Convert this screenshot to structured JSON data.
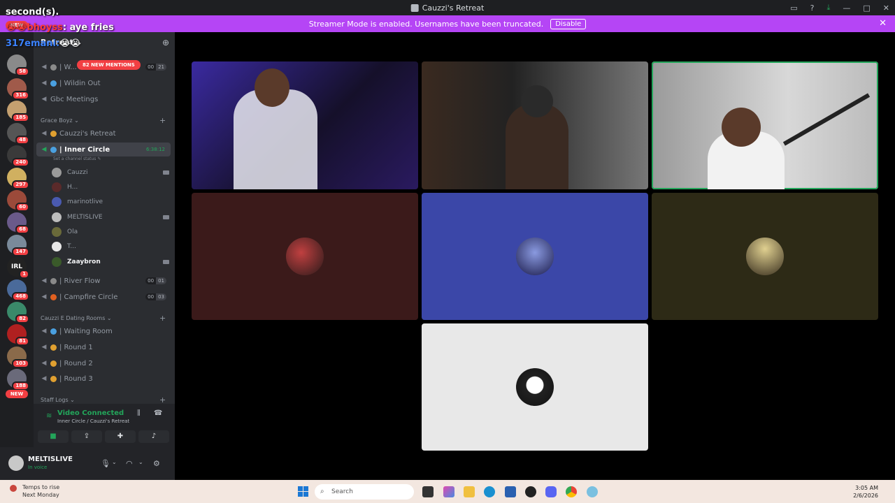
{
  "window": {
    "title": "Cauzzi's Retreat"
  },
  "banner": {
    "text": "Streamer Mode is enabled. Usernames have been truncated.",
    "button": "Disable"
  },
  "overlay": {
    "line1": "second(s).",
    "line2_user": "😭😭bhoyss",
    "line2_msg": "aye fries",
    "line3_user": "317emani:",
    "line3_tail": "😭😭"
  },
  "rail": {
    "new_top": "NEW",
    "new_bottom": "NEW",
    "badges": [
      "58",
      "316",
      "185",
      "48",
      "240",
      "297",
      "60",
      "68",
      "147",
      "1",
      "468",
      "82",
      "81",
      "103",
      "188"
    ],
    "irl_label": "IRL"
  },
  "sidebar": {
    "server_name": "Retreat",
    "mentions": "82 NEW MENTIONS",
    "top_channels": [
      {
        "name": "| W...",
        "pill": [
          "00",
          "21"
        ]
      },
      {
        "name": "| Wildin Out"
      },
      {
        "name": "Gbc Meetings"
      }
    ],
    "category1": "Grace Boyz",
    "ch_retreat": "Cauzzi's Retreat",
    "ch_inner": "| Inner Circle",
    "inner_timer": "6:38:12",
    "inner_status": "Set a channel status",
    "members": [
      "Cauzzi",
      "H...",
      "marinotlive",
      "MELTISLIVE",
      "Ola",
      "T...",
      "Zaaybron"
    ],
    "ch_river": {
      "name": "| River Flow",
      "pill": [
        "00",
        "01"
      ]
    },
    "ch_campfire": {
      "name": "| Campfire Circle",
      "pill": [
        "00",
        "03"
      ]
    },
    "category2": "Cauzzi E Dating Rooms",
    "dating": [
      "| Waiting Room",
      "| Round 1",
      "| Round 2",
      "| Round 3"
    ],
    "category3": "Staff Logs"
  },
  "voice": {
    "status": "Video Connected",
    "location": "Inner Circle / Cauzzi's Retreat"
  },
  "user": {
    "name": "MELTISLIVE",
    "status": "In voice"
  },
  "taskbar": {
    "weather_line1": "Temps to rise",
    "weather_line2": "Next Monday",
    "search": "Search",
    "time": "3:05 AM",
    "date": "2/6/2026"
  },
  "colors": {
    "accent": "#5865f2",
    "green": "#23a55a",
    "banner": "#b545f5",
    "mention_red": "#f23f43"
  }
}
